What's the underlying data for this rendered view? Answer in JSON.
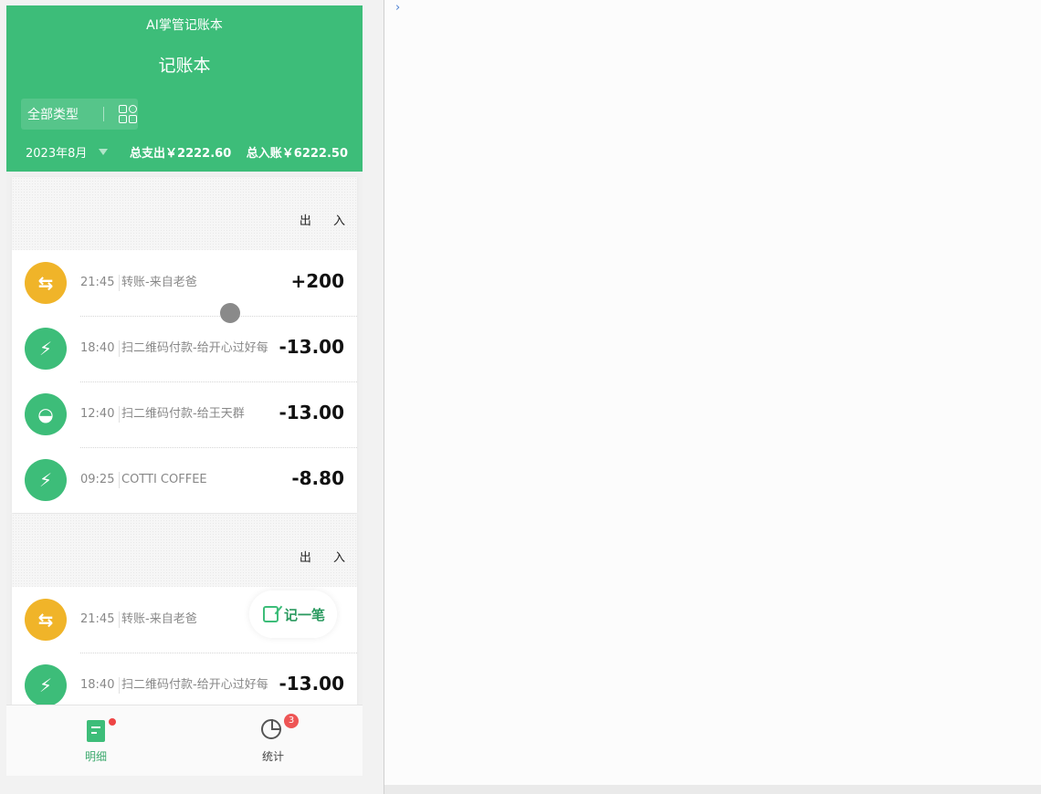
{
  "header": {
    "app_title": "AI掌管记账本",
    "page_title": "记账本",
    "type_filter": "全部类型",
    "month": "2023年8月",
    "total_expense": "总支出￥2222.60",
    "total_income": "总入账￥6222.50"
  },
  "days": [
    {
      "out_label": "出",
      "in_label": "入",
      "records": [
        {
          "time": "21:45",
          "desc": "转账-来自老爸",
          "amount": "+200",
          "icon": "transfer-icon",
          "color": "#f0b429",
          "glyph": "⇆"
        },
        {
          "time": "18:40",
          "desc": "扫二维码付款-给开心过好每",
          "amount": "-13.00",
          "icon": "drop-bolt-icon",
          "color": "#3dbd79",
          "glyph": "⚡"
        },
        {
          "time": "12:40",
          "desc": "扫二维码付款-给王天群",
          "amount": "-13.00",
          "icon": "bowl-icon",
          "color": "#3dbd79",
          "glyph": "◒"
        },
        {
          "time": "09:25",
          "desc": "COTTI COFFEE",
          "amount": "-8.80",
          "icon": "drop-bolt-icon",
          "color": "#3dbd79",
          "glyph": "⚡"
        }
      ]
    },
    {
      "out_label": "出",
      "in_label": "入",
      "records": [
        {
          "time": "21:45",
          "desc": "转账-来自老爸",
          "amount": "",
          "icon": "transfer-icon",
          "color": "#f0b429",
          "glyph": "⇆"
        },
        {
          "time": "18:40",
          "desc": "扫二维码付款-给开心过好每",
          "amount": "-13.00",
          "icon": "drop-bolt-icon",
          "color": "#3dbd79",
          "glyph": "⚡"
        }
      ]
    }
  ],
  "fab_label": "记一笔",
  "tabs": [
    {
      "label": "明细",
      "icon": "doc-icon"
    },
    {
      "label": "统计",
      "icon": "pie-chart-icon",
      "badge": "3"
    }
  ],
  "colors": {
    "brand": "#3dbd79",
    "transfer": "#f0b429",
    "badge": "#ee5555"
  }
}
